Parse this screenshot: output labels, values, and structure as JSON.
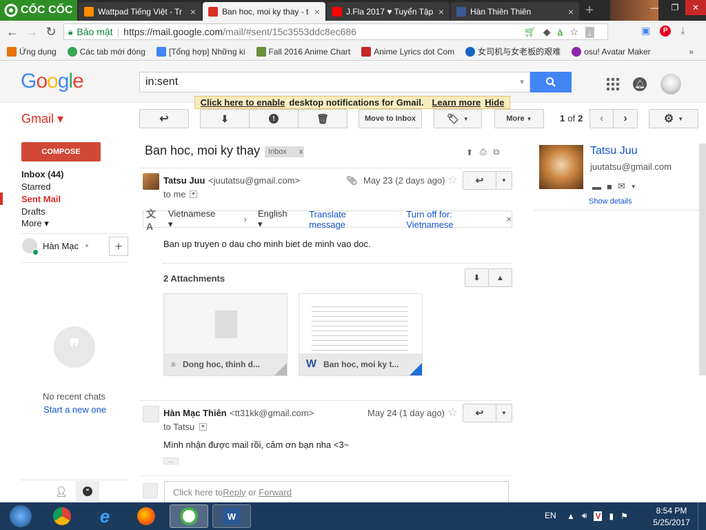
{
  "browser": {
    "brand": "CỐC CỐC",
    "tabs": [
      {
        "title": "Wattpad Tiếng Việt - Tr",
        "icon_color": "#ff8c00"
      },
      {
        "title": "Ban hoc, moi ky thay - t",
        "icon_color": "#d93025"
      },
      {
        "title": "J.Fla 2017 ♥ Tuyển Tập",
        "icon_color": "#ff0000"
      },
      {
        "title": "Hàn Thiên Thiên",
        "icon_color": "#3b5998"
      }
    ],
    "security_label": "Bảo mật",
    "url_base": "https://mail.google.com",
    "url_path": "/mail/#sent/15c3553ddc8ec686",
    "bookmarks": [
      {
        "label": "Ứng dụng",
        "icon_color": "#e8710a"
      },
      {
        "label": "Các tab mới đóng",
        "icon_color": "#34a853"
      },
      {
        "label": "[Tổng hợp] Những ki",
        "icon_color": "#4285f4"
      },
      {
        "label": "Fall 2016 Anime Chart",
        "icon_color": "#6a8e3c"
      },
      {
        "label": "Anime Lyrics dot Com",
        "icon_color": "#c62828"
      },
      {
        "label": "女司机与女老板的艰难",
        "icon_color": "#1565c0"
      },
      {
        "label": "osu! Avatar Maker",
        "icon_color": "#8e24aa"
      }
    ]
  },
  "google": {
    "search_value": "in:sent",
    "notice_link1": "Click here to enable",
    "notice_text": "desktop notifications for Gmail.",
    "notice_link2": "Learn more",
    "notice_link3": "Hide"
  },
  "toolbar": {
    "app_label": "Gmail ▾",
    "move_label": "Move to Inbox",
    "more_label": "More",
    "page_current": "1",
    "page_of": "of",
    "page_total": "2"
  },
  "sidebar": {
    "compose_label": "COMPOSE",
    "items": [
      {
        "label": "Inbox (44)",
        "bold": true
      },
      {
        "label": "Starred",
        "bold": false
      },
      {
        "label": "Sent Mail",
        "bold": true
      },
      {
        "label": "Drafts",
        "bold": false
      },
      {
        "label": "More ▾",
        "bold": false
      }
    ],
    "chat_user": "Hàn Mạc",
    "no_chats": "No recent chats",
    "start_new": "Start a new one"
  },
  "thread": {
    "subject": "Ban hoc, moi ky thay",
    "label_badge": "Inbox",
    "messages": [
      {
        "sender": "Tatsu Juu",
        "email": "<juutatsu@gmail.com>",
        "date": "May 23 (2 days ago)",
        "to": "to me",
        "body": "Ban up truyen o dau cho minh biet de minh vao doc."
      },
      {
        "sender": "Hàn Mạc Thiên",
        "email": "<tt31kk@gmail.com>",
        "date": "May 24 (1 day ago)",
        "to": "to Tatsu",
        "body": "Mình nhận được mail rồi, cảm ơn bạn nha <3~",
        "ellipsis": "..."
      }
    ],
    "translate": {
      "from": "Vietnamese ▾",
      "arrow": "›",
      "to": "English ▾",
      "translate_link": "Translate message",
      "turn_off": "Turn off for: Vietnamese"
    },
    "attachments_title": "2 Attachments",
    "attachments": [
      {
        "name": "Dong hoc, thinh d..."
      },
      {
        "name": "Ban hoc, moi ky t..."
      }
    ],
    "reply_placeholder_pre": "Click here to ",
    "reply_link": "Reply",
    "reply_mid": " or ",
    "forward_link": "Forward"
  },
  "contact": {
    "name": "Tatsu Juu",
    "email": "juutatsu@gmail.com",
    "show_details": "Show details"
  },
  "taskbar": {
    "lang": "EN",
    "time": "8:54 PM",
    "date": "5/25/2017"
  }
}
